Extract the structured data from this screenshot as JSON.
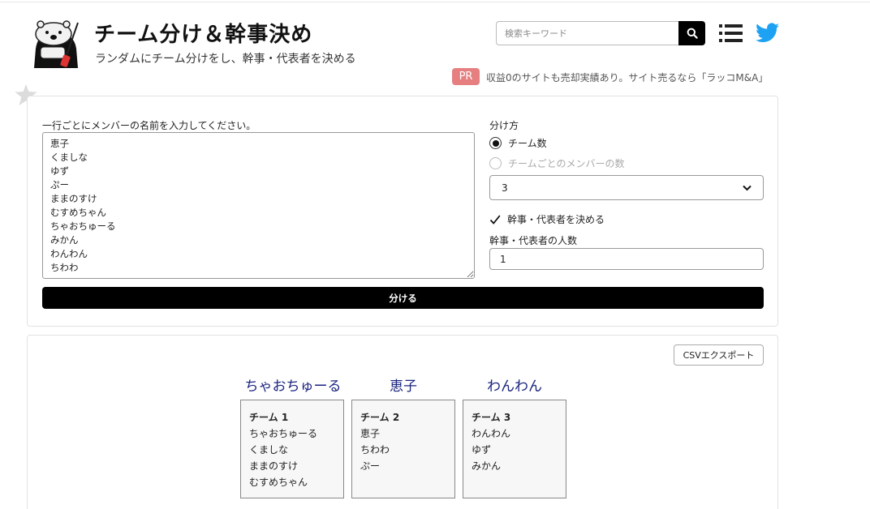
{
  "header": {
    "title": "チーム分け＆幹事決め",
    "subtitle": "ランダムにチーム分けをし、幹事・代表者を決める",
    "search_placeholder": "検索キーワード"
  },
  "pr": {
    "badge": "PR",
    "text": "収益0のサイトも売却実績あり。サイト売るなら「ラッコM&A」"
  },
  "form": {
    "members_label": "一行ごとにメンバーの名前を入力してください。",
    "members_value": "恵子\nくましな\nゆず\nぷー\nままのすけ\nむすめちゃん\nちゃおちゅーる\nみかん\nわんわん\nちわわ",
    "split_method_label": "分け方",
    "option_team_count": "チーム数",
    "option_members_per_team": "チームごとのメンバーの数",
    "selected_option": "team_count",
    "select_value": "3",
    "leader_checkbox_label": "幹事・代表者を決める",
    "leader_checked": true,
    "leader_count_label": "幹事・代表者の人数",
    "leader_count_value": "1",
    "split_button": "分ける"
  },
  "results": {
    "csv_button": "CSVエクスポート",
    "teams": [
      {
        "leader": "ちゃおちゅーる",
        "name": "チーム 1",
        "members": [
          "ちゃおちゅーる",
          "くましな",
          "ままのすけ",
          "むすめちゃん"
        ]
      },
      {
        "leader": "恵子",
        "name": "チーム 2",
        "members": [
          "恵子",
          "ちわわ",
          "ぷー"
        ]
      },
      {
        "leader": "わんわん",
        "name": "チーム 3",
        "members": [
          "わんわん",
          "ゆず",
          "みかん"
        ]
      }
    ]
  },
  "icons": {
    "search": "search-icon",
    "menu": "menu-icon",
    "twitter": "twitter-icon",
    "favorite": "star-icon",
    "logo": "otter-mascot-logo"
  },
  "colors": {
    "pr_badge": "#e57f80",
    "leader_text": "#1a237e",
    "twitter_blue": "#1da1f2",
    "button_black": "#000000"
  }
}
